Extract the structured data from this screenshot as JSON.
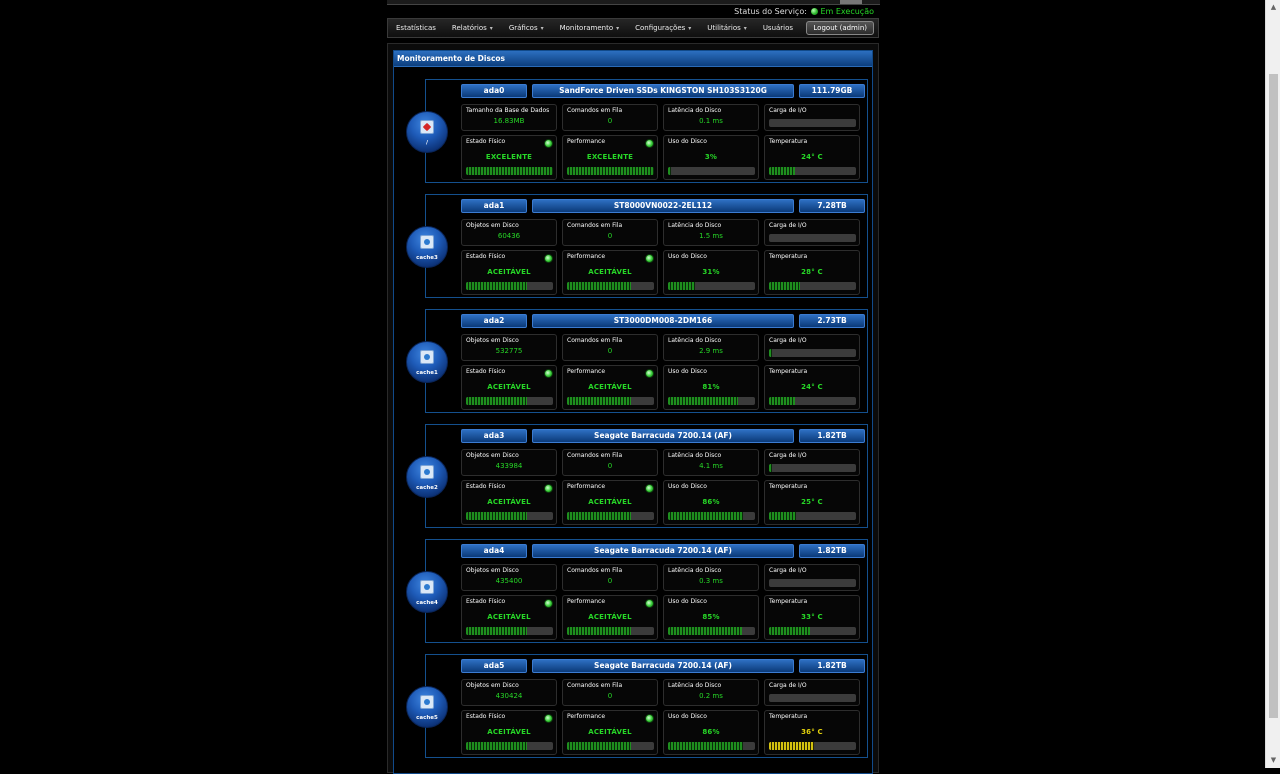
{
  "service_status": {
    "label": "Status do Serviço:",
    "value": "Em Execução"
  },
  "menu": [
    {
      "label": "Estatísticas",
      "dropdown": false
    },
    {
      "label": "Relatórios",
      "dropdown": true
    },
    {
      "label": "Gráficos",
      "dropdown": true
    },
    {
      "label": "Monitoramento",
      "dropdown": true
    },
    {
      "label": "Configurações",
      "dropdown": true
    },
    {
      "label": "Utilitários",
      "dropdown": true
    },
    {
      "label": "Usuários",
      "dropdown": false
    }
  ],
  "logout_label": "Logout (admin)",
  "panel_title": "Monitoramento de Discos",
  "labels": {
    "objects": "Objetos em Disco",
    "db_size": "Tamanho da Base de Dados",
    "queue": "Comandos em Fila",
    "latency": "Latência do Disco",
    "io_load": "Carga de I/O",
    "physical": "Estado Físico",
    "performance": "Performance",
    "usage": "Uso do Disco",
    "temperature": "Temperatura"
  },
  "disks": [
    {
      "name": "ada0",
      "model": "SandForce Driven SSDs KINGSTON SH103S3120G",
      "size": "111.79GB",
      "mount": "/",
      "icon": "ssd-red-icon",
      "first_label": "Tamanho da Base de Dados",
      "first_value": "16.83MB",
      "queue": "0",
      "latency": "0.1 ms",
      "io_load": 0.0,
      "physical": "EXCELENTE",
      "physical_level": 1.0,
      "performance": "EXCELENTE",
      "performance_level": 1.0,
      "usage": "3%",
      "usage_level": 0.03,
      "temperature": "24° C",
      "temp_level": 0.3,
      "temp_color": "#27d827"
    },
    {
      "name": "ada1",
      "model": "ST8000VN0022-2EL112",
      "size": "7.28TB",
      "mount": "cache3",
      "icon": "hdd-icon",
      "first_label": "Objetos em Disco",
      "first_value": "60436",
      "queue": "0",
      "latency": "1.5 ms",
      "io_load": 0.0,
      "physical": "ACEITÁVEL",
      "physical_level": 0.7,
      "performance": "ACEITÁVEL",
      "performance_level": 0.73,
      "usage": "31%",
      "usage_level": 0.31,
      "temperature": "28° C",
      "temp_level": 0.36,
      "temp_color": "#27d827"
    },
    {
      "name": "ada2",
      "model": "ST3000DM008-2DM166",
      "size": "2.73TB",
      "mount": "cache1",
      "icon": "hdd-icon",
      "first_label": "Objetos em Disco",
      "first_value": "532775",
      "queue": "0",
      "latency": "2.9 ms",
      "io_load": 0.03,
      "physical": "ACEITÁVEL",
      "physical_level": 0.7,
      "performance": "ACEITÁVEL",
      "performance_level": 0.73,
      "usage": "81%",
      "usage_level": 0.81,
      "temperature": "24° C",
      "temp_level": 0.3,
      "temp_color": "#27d827"
    },
    {
      "name": "ada3",
      "model": "Seagate Barracuda 7200.14 (AF)",
      "size": "1.82TB",
      "mount": "cache2",
      "icon": "hdd-icon",
      "first_label": "Objetos em Disco",
      "first_value": "433984",
      "queue": "0",
      "latency": "4.1 ms",
      "io_load": 0.03,
      "physical": "ACEITÁVEL",
      "physical_level": 0.7,
      "performance": "ACEITÁVEL",
      "performance_level": 0.73,
      "usage": "86%",
      "usage_level": 0.86,
      "temperature": "25° C",
      "temp_level": 0.31,
      "temp_color": "#27d827"
    },
    {
      "name": "ada4",
      "model": "Seagate Barracuda 7200.14 (AF)",
      "size": "1.82TB",
      "mount": "cache4",
      "icon": "hdd-icon",
      "first_label": "Objetos em Disco",
      "first_value": "435400",
      "queue": "0",
      "latency": "0.3 ms",
      "io_load": 0.0,
      "physical": "ACEITÁVEL",
      "physical_level": 0.7,
      "performance": "ACEITÁVEL",
      "performance_level": 0.73,
      "usage": "85%",
      "usage_level": 0.85,
      "temperature": "33° C",
      "temp_level": 0.47,
      "temp_color": "#27d827"
    },
    {
      "name": "ada5",
      "model": "Seagate Barracuda 7200.14 (AF)",
      "size": "1.82TB",
      "mount": "cache5",
      "icon": "hdd-icon",
      "first_label": "Objetos em Disco",
      "first_value": "430424",
      "queue": "0",
      "latency": "0.2 ms",
      "io_load": 0.0,
      "physical": "ACEITÁVEL",
      "physical_level": 0.7,
      "performance": "ACEITÁVEL",
      "performance_level": 0.73,
      "usage": "86%",
      "usage_level": 0.86,
      "temperature": "36° C",
      "temp_level": 0.52,
      "temp_color": "#e3d20d"
    }
  ]
}
